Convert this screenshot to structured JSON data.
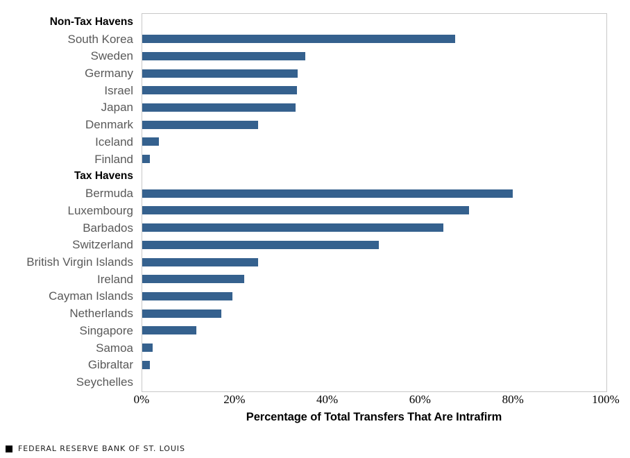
{
  "chart_data": {
    "type": "bar",
    "orientation": "horizontal",
    "title": "",
    "xlabel": "Percentage of Total Transfers That Are Intrafirm",
    "ylabel": "",
    "xlim": [
      0,
      100
    ],
    "xticks": [
      "0%",
      "20%",
      "40%",
      "60%",
      "80%",
      "100%"
    ],
    "xtick_values": [
      0,
      20,
      40,
      60,
      80,
      100
    ],
    "grid": false,
    "legend": null,
    "bar_color": "#35618E",
    "groups": [
      {
        "label": "Non-Tax Havens",
        "categories": [
          "South Korea",
          "Sweden",
          "Germany",
          "Israel",
          "Japan",
          "Denmark",
          "Iceland",
          "Finland"
        ],
        "values": [
          67.4,
          35.1,
          33.5,
          33.3,
          33.0,
          25.0,
          3.6,
          1.6
        ]
      },
      {
        "label": "Tax Havens",
        "categories": [
          "Bermuda",
          "Luxembourg",
          "Barbados",
          "Switzerland",
          "British Virgin Islands",
          "Ireland",
          "Cayman Islands",
          "Netherlands",
          "Singapore",
          "Samoa",
          "Gibraltar",
          "Seychelles"
        ],
        "values": [
          79.8,
          70.4,
          64.9,
          51.0,
          25.0,
          22.0,
          19.4,
          17.0,
          11.7,
          2.2,
          1.6,
          0.0
        ]
      }
    ]
  },
  "footer": {
    "text": "FEDERAL RESERVE BANK OF ST. LOUIS",
    "mark": "square-mark-icon"
  },
  "colors": {
    "bar": "#35618E",
    "label": "#595959",
    "header_label": "#000000",
    "frame": "#c8c8c8"
  }
}
